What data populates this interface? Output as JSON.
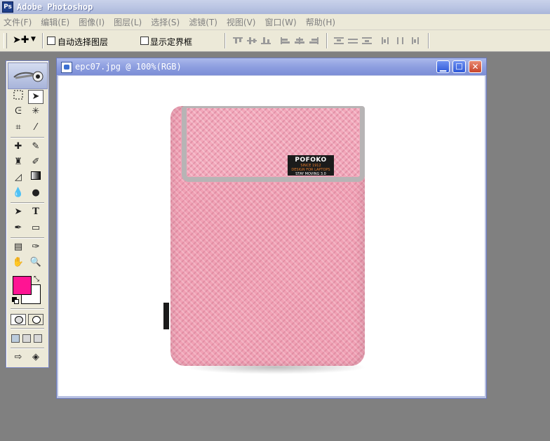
{
  "app": {
    "title": "Adobe Photoshop",
    "icon": "photoshop-app-icon"
  },
  "menu": {
    "items": [
      "文件(F)",
      "编辑(E)",
      "图像(I)",
      "图层(L)",
      "选择(S)",
      "滤镜(T)",
      "视图(V)",
      "窗口(W)",
      "帮助(H)"
    ]
  },
  "options": {
    "auto_select_layer_label": "自动选择图层",
    "show_bounding_box_label": "显示定界框",
    "auto_select_layer_checked": false,
    "show_bounding_box_checked": false
  },
  "toolbox": {
    "foreground_color": "#ff1493",
    "background_color": "#ffffff",
    "active_tool": "move-tool"
  },
  "document": {
    "title": "epc07.jpg @ 100%(RGB)",
    "image": {
      "brand_label": "POFOKO",
      "brand_sub1": "SINCE 1912",
      "brand_sub2": "DESIGN FOR LAPTOPS",
      "brand_sub3": "STAY MOVING 3.0"
    }
  }
}
